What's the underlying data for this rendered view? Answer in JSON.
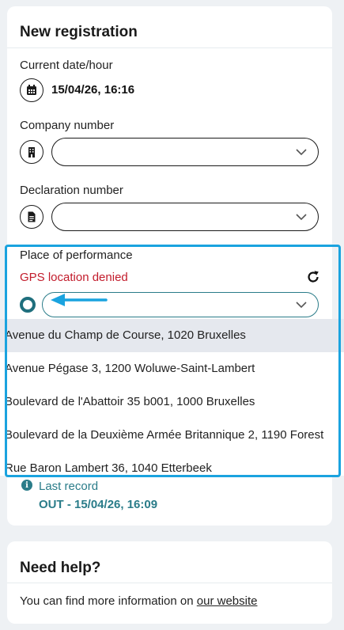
{
  "registration": {
    "title": "New registration",
    "current_date": {
      "label": "Current date/hour",
      "value": "15/04/26, 16:16",
      "icon": "calendar-icon"
    },
    "company_number": {
      "label": "Company number",
      "value": "",
      "icon": "building-icon"
    },
    "declaration_number": {
      "label": "Declaration number",
      "value": "",
      "icon": "document-icon"
    },
    "place_of_performance": {
      "label": "Place of performance",
      "gps_status": "GPS location denied",
      "value": "",
      "options": [
        "Avenue du Champ de Course, 1020 Bruxelles",
        "Avenue Pégase 3, 1200 Woluwe-Saint-Lambert",
        "Boulevard de l'Abattoir 35 b001, 1000 Bruxelles",
        "Boulevard de la Deuxième Armée Britannique 2, 1190 Forest",
        "Rue Baron Lambert 36, 1040 Etterbeek"
      ],
      "highlighted_index": 0
    },
    "last_record": {
      "label": "Last record",
      "value": "OUT - 15/04/26, 16:09"
    }
  },
  "help": {
    "title": "Need help?",
    "text": "You can find more information on",
    "link_text": "our website"
  },
  "colors": {
    "accent": "#2a7c89",
    "error": "#c21b2b",
    "annotation": "#1aa3df",
    "highlight_row": "#e5e8ee"
  }
}
